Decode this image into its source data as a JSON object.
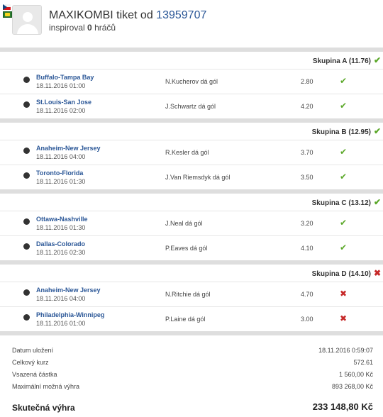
{
  "header": {
    "title_prefix": "MAXIKOMBI tiket od",
    "ticket_id": "13959707",
    "inspired_prefix": "inspiroval",
    "inspired_count": "0",
    "inspired_suffix": "hráčů",
    "flags": [
      "czech-flag-icon",
      "slovak-flag-icon"
    ]
  },
  "groups": [
    {
      "label": "Skupina A (11.76)",
      "status": "win",
      "bets": [
        {
          "match": "Buffalo-Tampa Bay",
          "date": "18.11.2016 01:00",
          "tip": "N.Kucherov dá gól",
          "odds": "2.80",
          "result": "win"
        },
        {
          "match": "St.Louis-San Jose",
          "date": "18.11.2016 02:00",
          "tip": "J.Schwartz dá gól",
          "odds": "4.20",
          "result": "win"
        }
      ]
    },
    {
      "label": "Skupina B (12.95)",
      "status": "win",
      "bets": [
        {
          "match": "Anaheim-New Jersey",
          "date": "18.11.2016 04:00",
          "tip": "R.Kesler dá gól",
          "odds": "3.70",
          "result": "win"
        },
        {
          "match": "Toronto-Florida",
          "date": "18.11.2016 01:30",
          "tip": "J.Van Riemsdyk dá gól",
          "odds": "3.50",
          "result": "win"
        }
      ]
    },
    {
      "label": "Skupina C (13.12)",
      "status": "win",
      "bets": [
        {
          "match": "Ottawa-Nashville",
          "date": "18.11.2016 01:30",
          "tip": "J.Neal dá gól",
          "odds": "3.20",
          "result": "win"
        },
        {
          "match": "Dallas-Colorado",
          "date": "18.11.2016 02:30",
          "tip": "P.Eaves dá gól",
          "odds": "4.10",
          "result": "win"
        }
      ]
    },
    {
      "label": "Skupina D (14.10)",
      "status": "lose",
      "bets": [
        {
          "match": "Anaheim-New Jersey",
          "date": "18.11.2016 04:00",
          "tip": "N.Ritchie dá gól",
          "odds": "4.70",
          "result": "lose"
        },
        {
          "match": "Philadelphia-Winnipeg",
          "date": "18.11.2016 01:00",
          "tip": "P.Laine dá gól",
          "odds": "3.00",
          "result": "lose"
        }
      ]
    }
  ],
  "summary": {
    "rows": [
      {
        "key": "Datum uložení",
        "value": "18.11.2016 0:59:07"
      },
      {
        "key": "Celkový kurz",
        "value": "572.61"
      },
      {
        "key": "Vsazená částka",
        "value": "1 560,00 Kč"
      },
      {
        "key": "Maximální možná výhra",
        "value": "893 268,00 Kč"
      }
    ],
    "actual_win_label": "Skutečná výhra",
    "actual_win_value": "233 148,80 Kč"
  },
  "icons": {
    "win": "check-icon",
    "lose": "cross-icon",
    "win_color": "#5ba829",
    "lose_color": "#c62828",
    "link_color": "#2b5797"
  }
}
